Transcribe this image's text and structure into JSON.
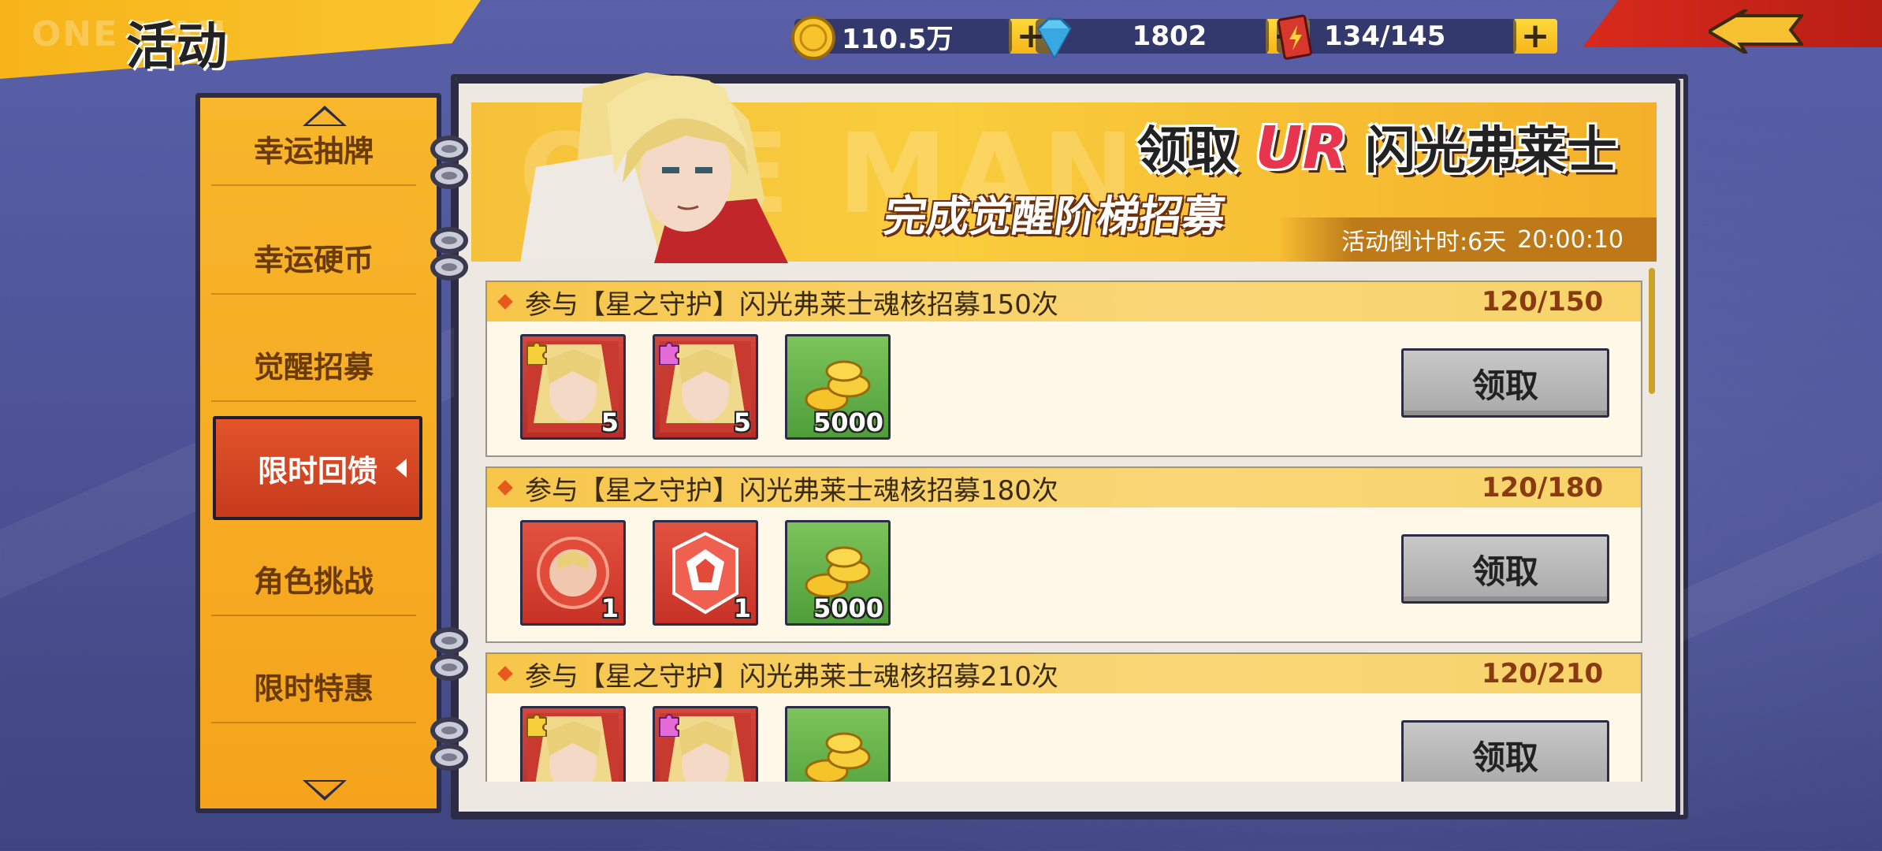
{
  "header": {
    "title": "活动",
    "banner_ghost_text": "ONE    MAN"
  },
  "currency": [
    {
      "icon": "gold-coin-icon",
      "value": "110.5万",
      "plus": "+"
    },
    {
      "icon": "diamond-icon",
      "value": "1802",
      "plus": "+"
    },
    {
      "icon": "stamina-card-icon",
      "value": "134/145",
      "plus": "+"
    }
  ],
  "sidebar": {
    "items": [
      {
        "label": "幸运抽牌",
        "active": false
      },
      {
        "label": "幸运硬币",
        "active": false
      },
      {
        "label": "觉醒招募",
        "active": false
      },
      {
        "label": "限时回馈",
        "active": true
      },
      {
        "label": "角色挑战",
        "active": false
      },
      {
        "label": "限时特惠",
        "active": false
      }
    ]
  },
  "banner": {
    "title_prefix": "领取",
    "title_ur": "UR",
    "title_name": "闪光弗莱士",
    "subtitle": "完成觉醒阶梯招募",
    "countdown_label": "活动倒计时:6天",
    "countdown_time": "20:00:10"
  },
  "tasks": [
    {
      "name": "参与【星之守护】闪光弗莱士魂核招募150次",
      "progress": "120/150",
      "claim_label": "领取",
      "rewards": [
        {
          "type": "card",
          "badge": "yellow-puzzle",
          "qty": "5"
        },
        {
          "type": "card",
          "badge": "pink-puzzle",
          "qty": "5"
        },
        {
          "type": "gold",
          "qty": "5000"
        }
      ]
    },
    {
      "name": "参与【星之守护】闪光弗莱士魂核招募180次",
      "progress": "120/180",
      "claim_label": "领取",
      "rewards": [
        {
          "type": "red-orb",
          "qty": "1"
        },
        {
          "type": "red-emblem",
          "qty": "1"
        },
        {
          "type": "gold",
          "qty": "5000"
        }
      ]
    },
    {
      "name": "参与【星之守护】闪光弗莱士魂核招募210次",
      "progress": "120/210",
      "claim_label": "领取",
      "rewards": [
        {
          "type": "card",
          "badge": "yellow-puzzle",
          "qty": ""
        },
        {
          "type": "card",
          "badge": "pink-puzzle",
          "qty": ""
        },
        {
          "type": "gold",
          "qty": ""
        }
      ]
    }
  ],
  "colors": {
    "accent_orange": "#f6b41a",
    "active_tab": "#d2462a",
    "progress_text": "#8a3a10",
    "banner_title": "#e8344d"
  }
}
